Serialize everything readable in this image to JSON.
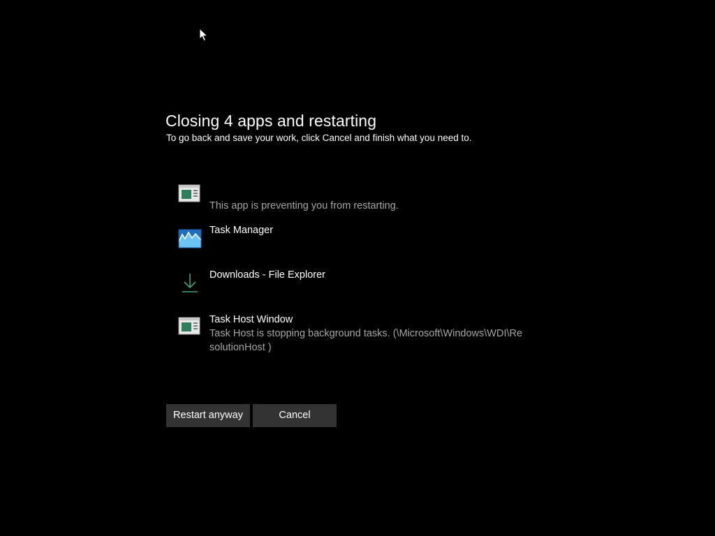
{
  "dialog": {
    "title": "Closing 4 apps and restarting",
    "subtitle": "To go back and save your work, click Cancel and finish what you need to."
  },
  "apps": [
    {
      "name": "",
      "description": "This app is preventing you from restarting.",
      "icon": "generic-window-icon"
    },
    {
      "name": "Task Manager",
      "description": "",
      "icon": "task-manager-icon"
    },
    {
      "name": "Downloads - File Explorer",
      "description": "",
      "icon": "download-arrow-icon"
    },
    {
      "name": "Task Host Window",
      "description": "Task Host is stopping background tasks. (\\Microsoft\\Windows\\WDI\\ResolutionHost )",
      "icon": "generic-window-icon"
    }
  ],
  "buttons": {
    "restart_label": "Restart anyway",
    "cancel_label": "Cancel"
  },
  "colors": {
    "background": "#000000",
    "text": "#ffffff",
    "secondary_text": "#a6a6a6",
    "button": "#333333",
    "download_accent": "#3fa37a",
    "task_manager_accent": "#2f8fd8"
  }
}
